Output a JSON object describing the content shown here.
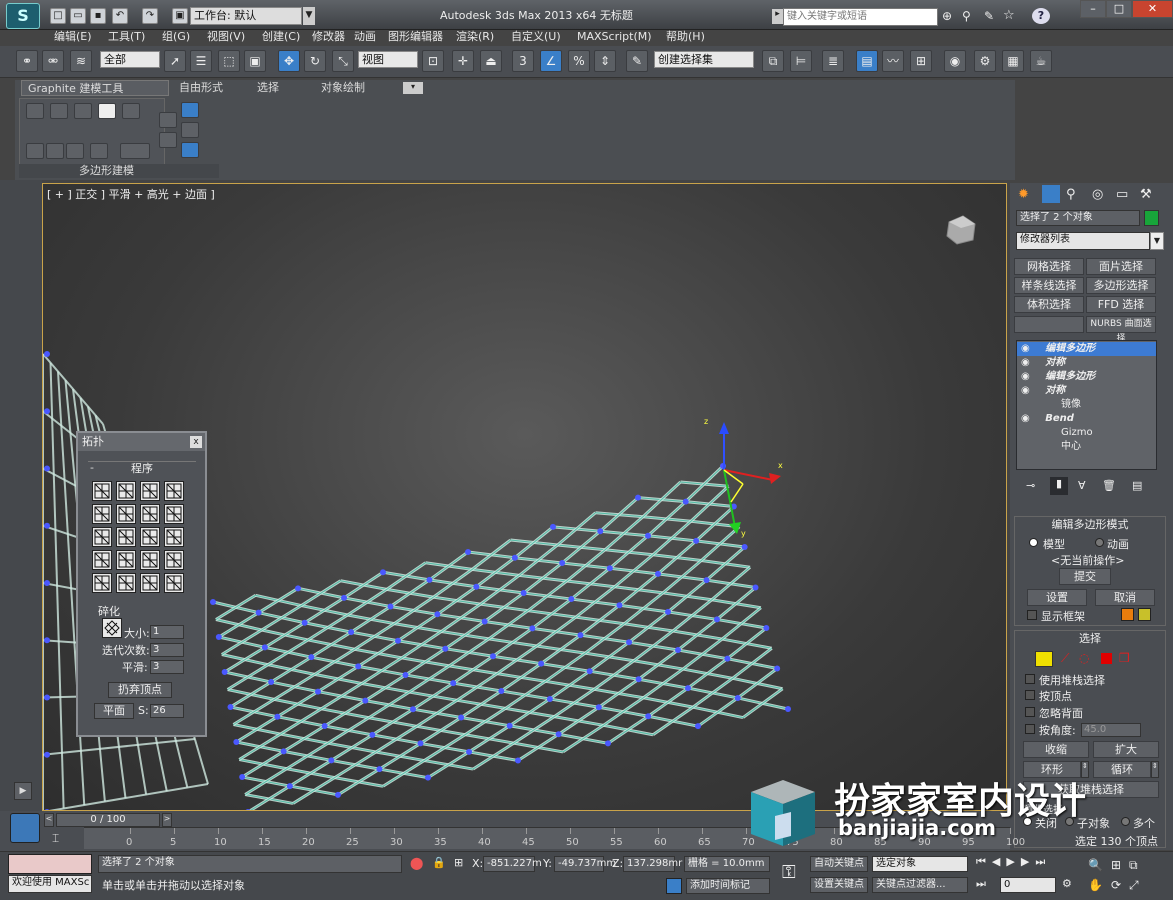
{
  "titlebar": {
    "workspace_label": "工作台: 默认",
    "app_title": "Autodesk 3ds Max  2013 x64      无标题",
    "search_placeholder": "键入关键字或短语"
  },
  "menu": [
    "编辑(E)",
    "工具(T)",
    "组(G)",
    "视图(V)",
    "创建(C)",
    "修改器",
    "动画",
    "图形编辑器",
    "渲染(R)",
    "自定义(U)",
    "MAXScript(M)",
    "帮助(H)"
  ],
  "toolbar": {
    "filter_value": "全部",
    "refcoord_value": "视图",
    "selset_value": "创建选择集"
  },
  "ribbon": {
    "tabs": [
      "Graphite 建模工具",
      "自由形式",
      "选择",
      "对象绘制"
    ],
    "panel_label": "多边形建模"
  },
  "viewport": {
    "label": "[ + ] 正交 ] 平滑 + 高光 + 边面 ]",
    "axis_x": "x",
    "axis_y": "y",
    "axis_z": "z"
  },
  "dialog": {
    "title": "拓扑",
    "section_program": "程序",
    "section_subdiv": "碎化",
    "size_label": "大小:",
    "size_value": "1",
    "iter_label": "迭代次数:",
    "iter_value": "3",
    "smooth_label": "平滑:",
    "smooth_value": "3",
    "discard_button": "扔弃顶点",
    "plane_button": "平面",
    "s_label": "S:",
    "s_value": "26"
  },
  "command_panel": {
    "object_name": "选择了 2 个对象",
    "modifier_list": "修改器列表",
    "buttons": [
      "网格选择",
      "面片选择",
      "样条线选择",
      "多边形选择",
      "体积选择",
      "FFD 选择",
      "",
      "NURBS 曲面选择"
    ],
    "stack": [
      {
        "name": "编辑多边形",
        "indent": false,
        "selected": true
      },
      {
        "name": "对称",
        "indent": false
      },
      {
        "name": "编辑多边形",
        "indent": false
      },
      {
        "name": "对称",
        "indent": false
      },
      {
        "name": "镜像",
        "indent": true
      },
      {
        "name": "Bend",
        "indent": false
      },
      {
        "name": "Gizmo",
        "indent": true
      },
      {
        "name": "中心",
        "indent": true
      }
    ],
    "edit_poly_mode": {
      "title": "编辑多边形模式",
      "model": "模型",
      "animate": "动画",
      "no_op": "<无当前操作>",
      "commit": "提交",
      "settings": "设置",
      "cancel": "取消",
      "show_cage": "显示框架"
    },
    "selection": {
      "title": "选择",
      "use_stack": "使用堆栈选择",
      "by_vertex": "按顶点",
      "ignore_backface": "忽略背面",
      "by_angle": "按角度:",
      "angle_value": "45.0",
      "shrink": "收缩",
      "grow": "扩大",
      "ring": "环形",
      "loop": "循环",
      "get_stack": "获取堆栈选择",
      "preview": "预览选择",
      "off": "关闭",
      "subobj": "子对象",
      "multi": "多个",
      "count": "选定 130 个顶点"
    },
    "cage_color_1": "#e87d0d",
    "cage_color_2": "#c8c02a"
  },
  "timeline": {
    "frame_label": "0 / 100",
    "ticks": [
      "0",
      "5",
      "10",
      "15",
      "20",
      "25",
      "30",
      "35",
      "40",
      "45",
      "50",
      "55",
      "60",
      "65",
      "70",
      "75",
      "80",
      "85",
      "90",
      "95",
      "100"
    ]
  },
  "status": {
    "welcome": "欢迎使用 MAXSc",
    "selected": "选择了 2 个对象",
    "prompt": "单击或单击并拖动以选择对象",
    "x_label": "X:",
    "x_value": "-851.227m",
    "y_label": "Y:",
    "y_value": "-49.737mm",
    "z_label": "Z:",
    "z_value": "137.298mr",
    "grid": "栅格 = 10.0mm",
    "add_tag": "添加时间标记",
    "auto_key": "自动关键点",
    "set_key": "设置关键点",
    "key_mode": "选定对象",
    "key_filter": "关键点过滤器...",
    "frame_value": "0"
  },
  "watermark": {
    "text": "扮家家室内设计",
    "url": "banjiajia.com"
  }
}
